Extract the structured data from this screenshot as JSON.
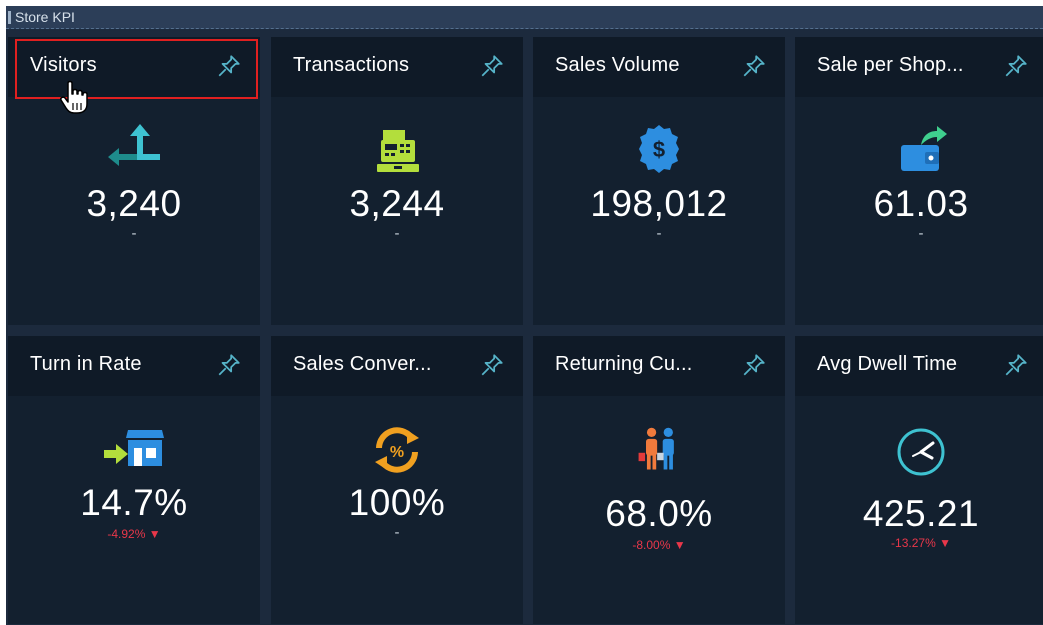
{
  "panel": {
    "title": "Store KPI"
  },
  "tiles": [
    {
      "title": "Visitors",
      "value": "3,240",
      "delta": "-",
      "icon": "entrance-arrow-icon"
    },
    {
      "title": "Transactions",
      "value": "3,244",
      "delta": "-",
      "icon": "cash-register-icon"
    },
    {
      "title": "Sales Volume",
      "value": "198,012",
      "delta": "-",
      "icon": "dollar-badge-icon"
    },
    {
      "title": "Sale per Shop...",
      "value": "61.03",
      "delta": "-",
      "icon": "wallet-icon"
    },
    {
      "title": "Turn in Rate",
      "value": "14.7%",
      "delta": "-4.92% ▼",
      "icon": "store-entry-icon"
    },
    {
      "title": "Sales Conver...",
      "value": "100%",
      "delta": "-",
      "icon": "percent-cycle-icon"
    },
    {
      "title": "Returning Cu...",
      "value": "68.0%",
      "delta": "-8.00% ▼",
      "icon": "shoppers-icon"
    },
    {
      "title": "Avg Dwell Time",
      "value": "425.21",
      "delta": "-13.27% ▼",
      "icon": "clock-icon"
    }
  ],
  "colors": {
    "background": "#1c2a3d",
    "tile": "#13202f",
    "tile_header": "#0f1a27",
    "negative": "#e9374a",
    "highlight": "#e02020"
  }
}
